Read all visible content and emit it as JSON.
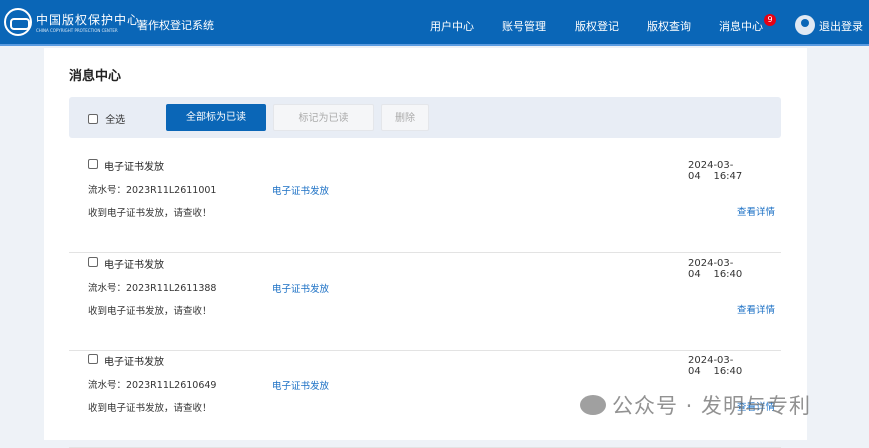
{
  "header": {
    "logo_text": "中国版权保护中心",
    "logo_sub": "CHINA COPYRIGHT PROTECTION CENTER",
    "system": "著作权登记系统",
    "nav": [
      "用户中心",
      "账号管理",
      "版权登记",
      "版权查询",
      "消息中心"
    ],
    "badge": "9",
    "logout": "退出登录"
  },
  "page": {
    "title": "消息中心"
  },
  "toolbar": {
    "select_all": "全选",
    "mark_all": "全部标为已读",
    "mark_read": "标记为已读",
    "delete": "删除"
  },
  "messages": [
    {
      "title": "电子证书发放",
      "serial": "流水号：2023R11L2611001",
      "type": "电子证书发放",
      "body": "收到电子证书发放，请查收！",
      "date": "2024-03-04",
      "time": "16:47",
      "link": "查看详情"
    },
    {
      "title": "电子证书发放",
      "serial": "流水号：2023R11L2611388",
      "type": "电子证书发放",
      "body": "收到电子证书发放，请查收！",
      "date": "2024-03-04",
      "time": "16:40",
      "link": "查看详情"
    },
    {
      "title": "电子证书发放",
      "serial": "流水号：2023R11L2610649",
      "type": "电子证书发放",
      "body": "收到电子证书发放，请查收！",
      "date": "2024-03-04",
      "time": "16:40",
      "link": "查看详情"
    }
  ],
  "watermark": "公众号 · 发明与专利",
  "colors": {
    "primary": "#0a66b7",
    "link": "#1a6fc4",
    "badge": "#e60012"
  }
}
